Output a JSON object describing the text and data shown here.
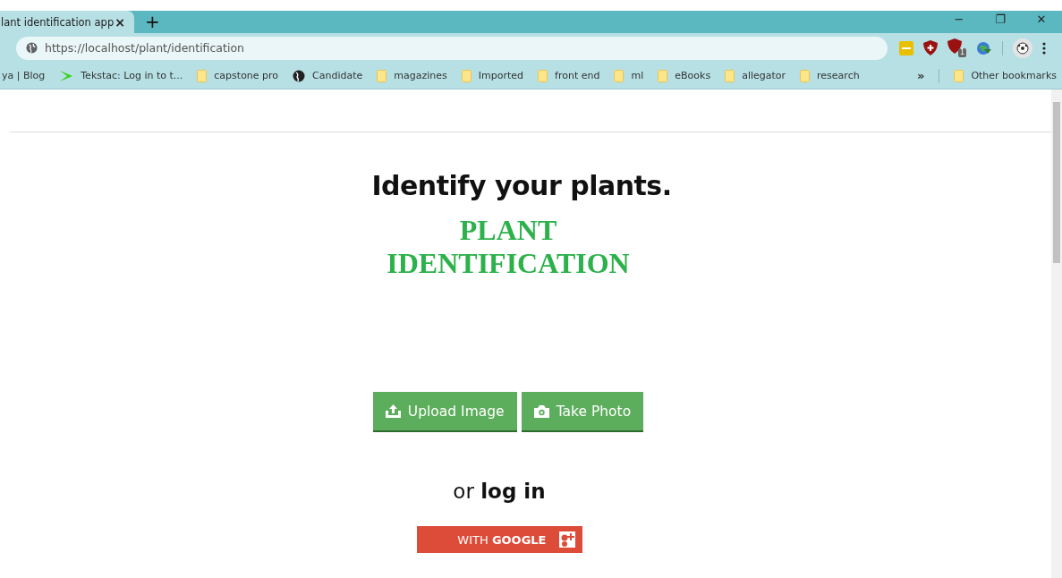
{
  "tab": {
    "title": "lant identification app",
    "close": "×",
    "new_tab": "+"
  },
  "window_controls": {
    "minimize": "−",
    "restore": "❐",
    "close": "✕"
  },
  "address_bar": {
    "value": "https://localhost/plant/identification"
  },
  "extensions": [
    {
      "kind": "game"
    },
    {
      "kind": "shield"
    },
    {
      "kind": "ublock",
      "text": "1"
    },
    {
      "kind": "globe"
    }
  ],
  "bookmarks": [
    {
      "kind": "none",
      "label": "ya | Blog"
    },
    {
      "kind": "arrow",
      "label": "Tekstac: Log in to t..."
    },
    {
      "kind": "folder",
      "label": "capstone pro"
    },
    {
      "kind": "globe",
      "label": "Candidate"
    },
    {
      "kind": "folder",
      "label": "magazines"
    },
    {
      "kind": "folder",
      "label": "Imported"
    },
    {
      "kind": "folder",
      "label": "front end"
    },
    {
      "kind": "folder",
      "label": "ml"
    },
    {
      "kind": "folder",
      "label": "eBooks"
    },
    {
      "kind": "folder",
      "label": "allegator"
    },
    {
      "kind": "folder",
      "label": "research"
    }
  ],
  "bookmarks_more": "»",
  "other_bookmarks": "Other bookmarks",
  "page": {
    "heading": "Identify your plants.",
    "title_line_1": "PLANT",
    "title_line_2": "IDENTIFICATION",
    "buttons": [
      {
        "kind": "upload",
        "label": "Upload Image"
      },
      {
        "kind": "camera",
        "label": "Take Photo"
      }
    ],
    "login_text": "or **log in**",
    "google_button": "WITH **GOOGLE**"
  }
}
